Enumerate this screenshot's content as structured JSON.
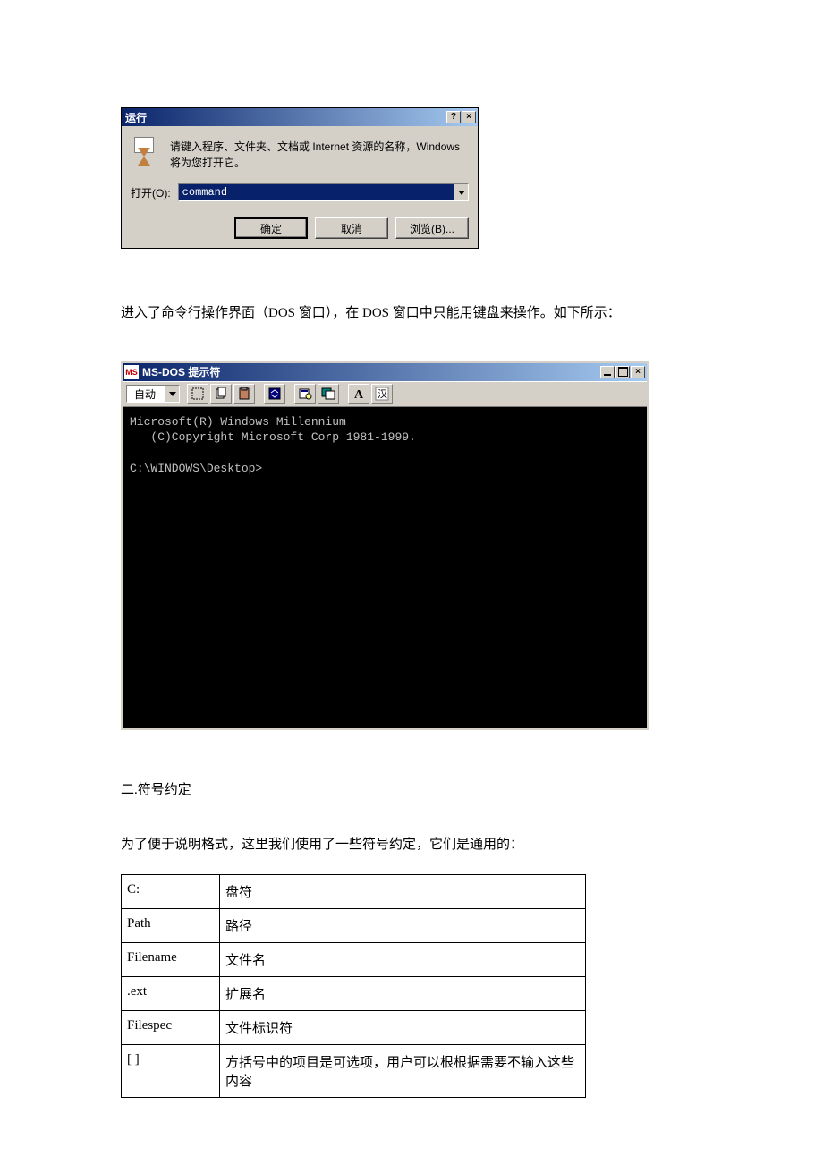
{
  "run_dialog": {
    "title": "运行",
    "help_btn": "?",
    "close_btn": "×",
    "description": "请键入程序、文件夹、文档或 Internet 资源的名称，Windows 将为您打开它。",
    "open_label": "打开(O):",
    "input_value": "command",
    "buttons": {
      "ok": "确定",
      "cancel": "取消",
      "browse": "浏览(B)..."
    }
  },
  "para1": "进入了命令行操作界面（DOS 窗口），在 DOS 窗口中只能用键盘来操作。如下所示：",
  "dos_window": {
    "title": "MS-DOS 提示符",
    "auto_label": "自动",
    "console_lines": [
      "Microsoft(R) Windows Millennium",
      "   (C)Copyright Microsoft Corp 1981-1999.",
      "",
      "C:\\WINDOWS\\Desktop>"
    ]
  },
  "section2_title": "二.符号约定",
  "para2": "为了便于说明格式，这里我们使用了一些符号约定，它们是通用的：",
  "conventions": [
    {
      "sym": "C:",
      "desc": "盘符"
    },
    {
      "sym": "Path",
      "desc": "路径"
    },
    {
      "sym": "Filename",
      "desc": "文件名"
    },
    {
      "sym": ".ext",
      "desc": "扩展名"
    },
    {
      "sym": "Filespec",
      "desc": "文件标识符"
    },
    {
      "sym": "[ ]",
      "desc": "方括号中的项目是可选项，用户可以根根据需要不输入这些内容"
    }
  ]
}
